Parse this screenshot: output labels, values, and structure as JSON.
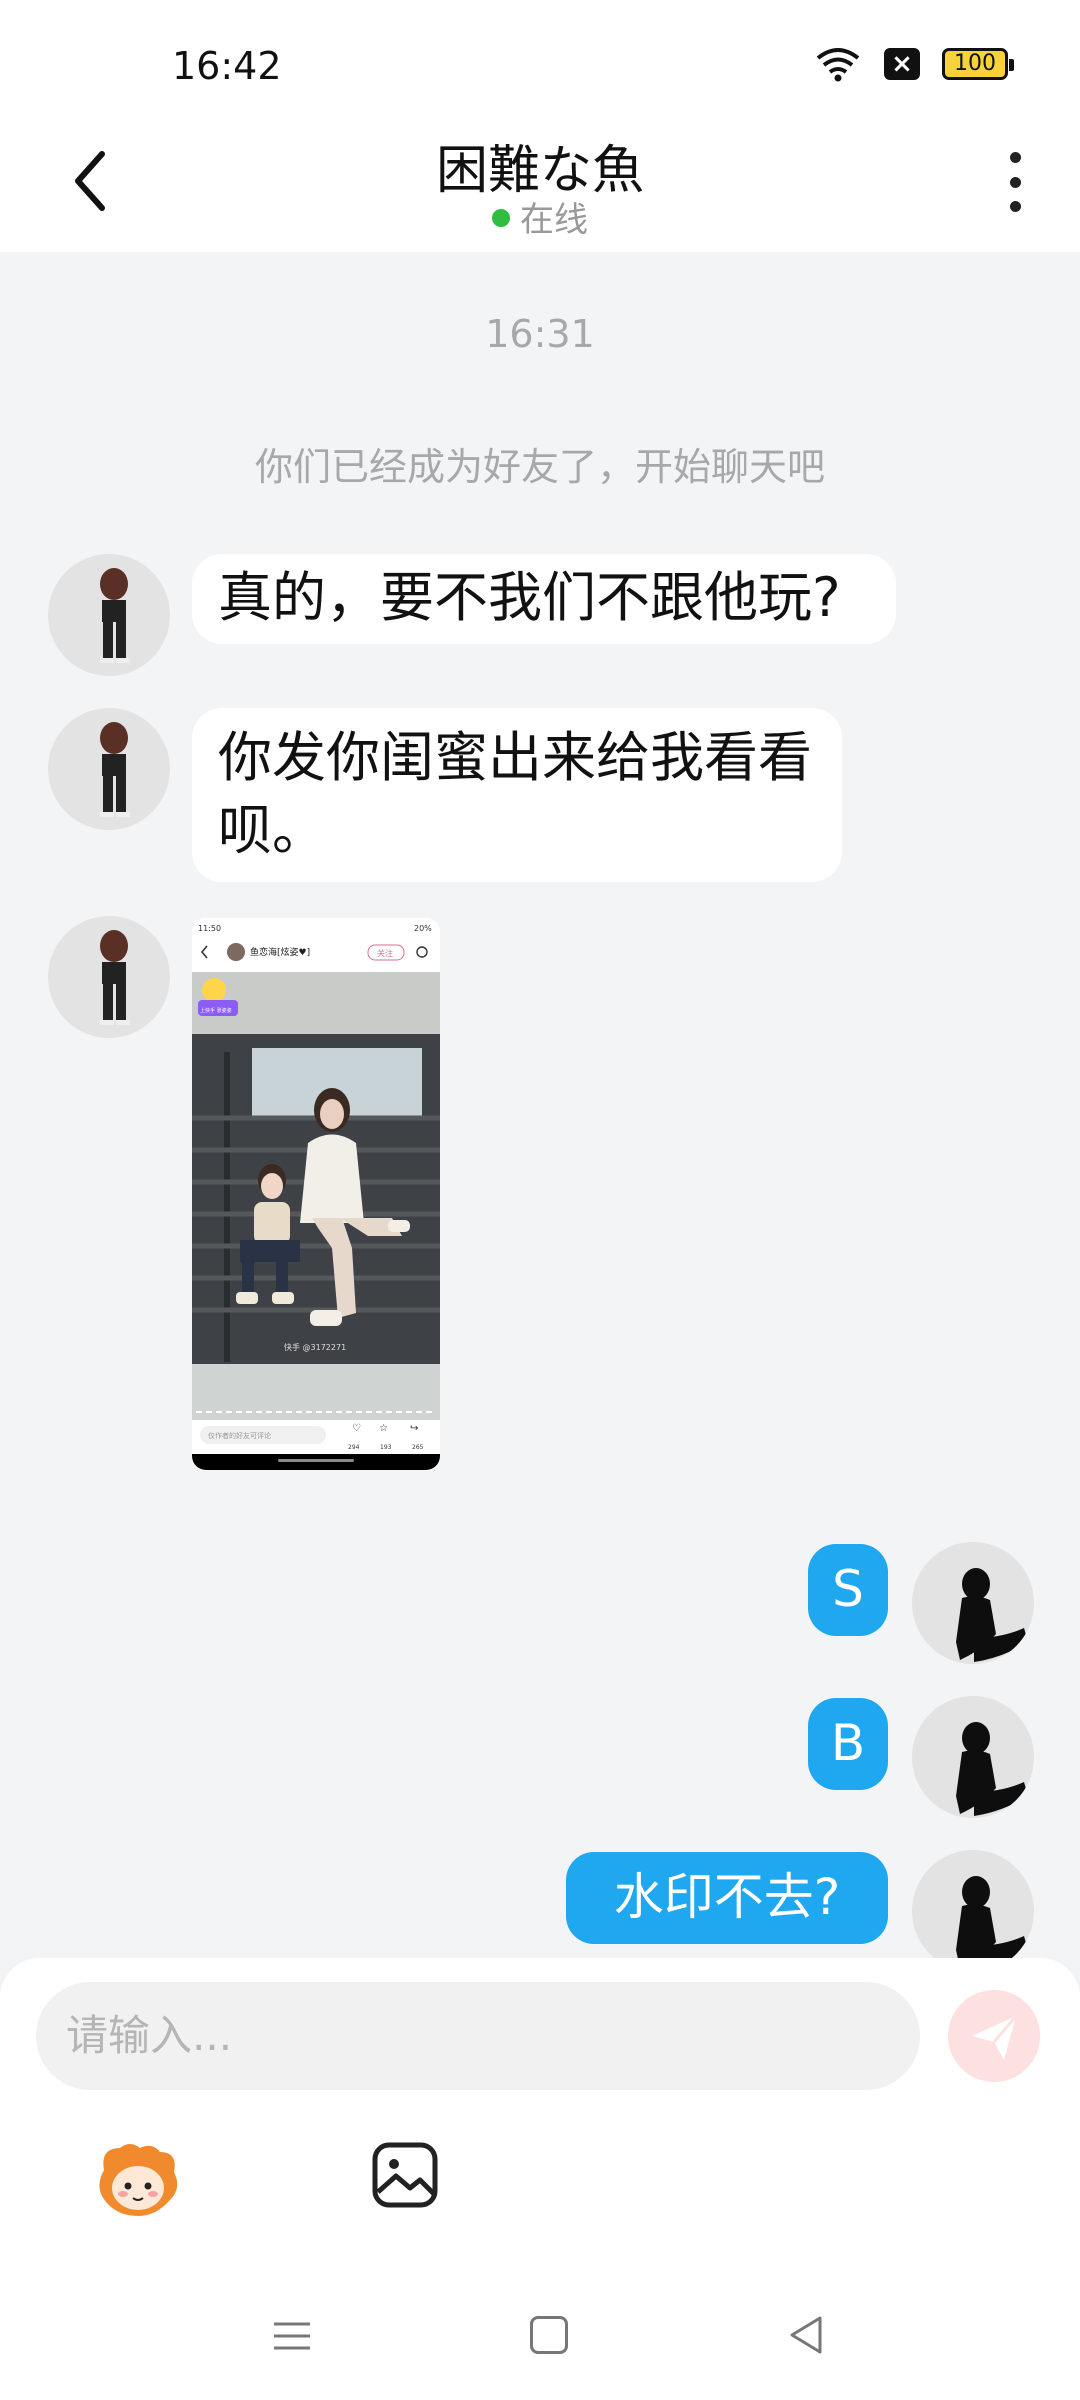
{
  "status_bar": {
    "time": "16:42",
    "battery": "100"
  },
  "header": {
    "title": "困難な魚",
    "status": "在线"
  },
  "chat": {
    "time_label": "16:31",
    "system_message": "你们已经成为好友了，开始聊天吧",
    "incoming": [
      {
        "text": "真的，要不我们不跟他玩?"
      },
      {
        "text": "你发你闺蜜出来给我看看呗。"
      }
    ],
    "screenshot": {
      "status_time": "11:50",
      "battery": "20%",
      "username": "鱼恋海[炫姿♥]",
      "follow_label": "关注",
      "sticker_text": "上快手 涨姿姿",
      "watermark": "快手 @3172271",
      "comment_placeholder": "仅作者的好友可评论",
      "likes": "294",
      "stars": "193",
      "shares": "265"
    },
    "outgoing": [
      {
        "text": "S"
      },
      {
        "text": "B"
      },
      {
        "text": "水印不去?"
      }
    ]
  },
  "composer": {
    "placeholder": "请输入..."
  },
  "colors": {
    "accent": "#1fa7f0",
    "online": "#2fbd3f",
    "background": "#f3f4f6"
  },
  "icons": [
    "back-icon",
    "more-icon",
    "emoji-icon",
    "image-icon",
    "send-icon"
  ]
}
